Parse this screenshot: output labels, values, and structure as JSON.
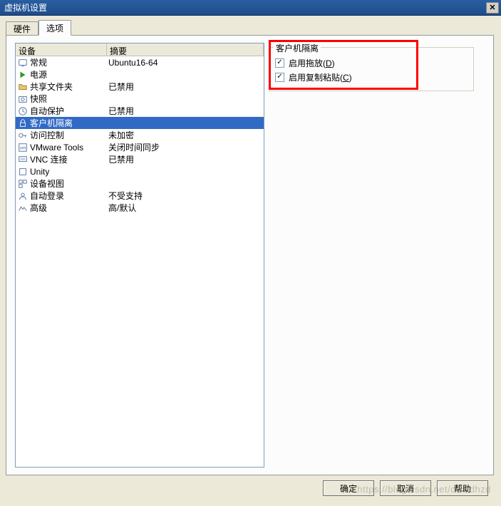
{
  "window": {
    "title": "虚拟机设置"
  },
  "tabs": {
    "hardware": "硬件",
    "options": "选项"
  },
  "list": {
    "header_device": "设备",
    "header_summary": "摘要",
    "rows": [
      {
        "icon": "general-icon",
        "device": "常规",
        "summary": "Ubuntu16-64"
      },
      {
        "icon": "power-icon",
        "device": "电源",
        "summary": ""
      },
      {
        "icon": "folder-icon",
        "device": "共享文件夹",
        "summary": "已禁用"
      },
      {
        "icon": "snapshot-icon",
        "device": "快照",
        "summary": ""
      },
      {
        "icon": "clock-icon",
        "device": "自动保护",
        "summary": "已禁用"
      },
      {
        "icon": "lock-icon",
        "device": "客户机隔离",
        "summary": "",
        "selected": true
      },
      {
        "icon": "key-icon",
        "device": "访问控制",
        "summary": "未加密"
      },
      {
        "icon": "tools-icon",
        "device": "VMware Tools",
        "summary": "关闭时间同步"
      },
      {
        "icon": "vnc-icon",
        "device": "VNC 连接",
        "summary": "已禁用"
      },
      {
        "icon": "unity-icon",
        "device": "Unity",
        "summary": ""
      },
      {
        "icon": "device-icon",
        "device": "设备视图",
        "summary": ""
      },
      {
        "icon": "login-icon",
        "device": "自动登录",
        "summary": "不受支持"
      },
      {
        "icon": "advanced-icon",
        "device": "高级",
        "summary": "高/默认"
      }
    ]
  },
  "detail": {
    "group_title": "客户机隔离",
    "chk_drag_label_pre": "启用拖放(",
    "chk_drag_key": "D",
    "chk_drag_label_post": ")",
    "chk_copy_label_pre": "启用复制粘贴(",
    "chk_copy_key": "C",
    "chk_copy_label_post": ")"
  },
  "buttons": {
    "ok": "确定",
    "cancel": "取消",
    "help": "帮助"
  },
  "watermark": "https://blog.csdn.net/deaidhzd"
}
